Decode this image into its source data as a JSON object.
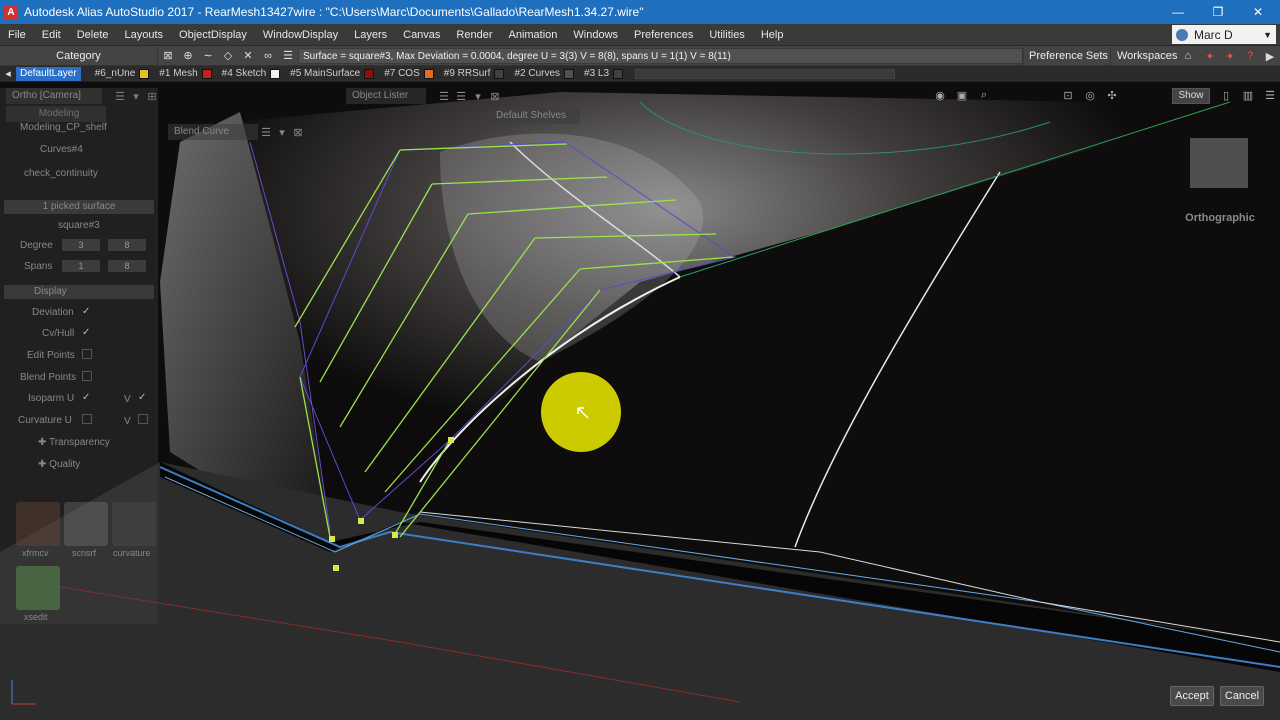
{
  "window": {
    "title": "Autodesk Alias AutoStudio 2017      - RearMesh13427wire : \"C:\\Users\\Marc\\Documents\\Gallado\\RearMesh1.34.27.wire\"",
    "controls": [
      "—",
      "❐",
      "✕"
    ]
  },
  "menu": {
    "items": [
      "File",
      "Edit",
      "Delete",
      "Layouts",
      "ObjectDisplay",
      "WindowDisplay",
      "Layers",
      "Canvas",
      "Render",
      "Animation",
      "Windows",
      "Preferences",
      "Utilities",
      "Help"
    ],
    "user": "Marc D"
  },
  "toolbar": {
    "category": "Category",
    "info": "Surface = square#3, Max Deviation = 0.0004, degree U = 3(3) V = 8(8), spans U = 1(1) V = 8(11)",
    "preference_sets": "Preference Sets",
    "workspaces": "Workspaces"
  },
  "layers": [
    {
      "label": "DefaultLayer",
      "color": "#2a6fc9",
      "active": true
    },
    {
      "label": "#6_nUne",
      "color": "#e8c020"
    },
    {
      "label": "#1 Mesh",
      "color": "#c02020"
    },
    {
      "label": "#4 Sketch",
      "color": "#f0f0f0"
    },
    {
      "label": "#5 MainSurface",
      "color": "#8a1010"
    },
    {
      "label": "#7 COS",
      "color": "#e07020"
    },
    {
      "label": "#9 RRSurf",
      "color": "#404040"
    },
    {
      "label": "#2 Curves",
      "color": "#505050"
    },
    {
      "label": "#3 L3",
      "color": "#404040"
    }
  ],
  "viewport": {
    "camera_label": "Ortho [Camera]",
    "modeling_label": "Modeling",
    "object_lister": "Object Lister",
    "default_shelves": "Default Shelves",
    "blend_curve": "Blend Curve",
    "view_label": "Orthographic",
    "show_button": "Show"
  },
  "leftpanel": {
    "shelf": "Modeling_CP_shelf",
    "curves": "Curves#4",
    "check": "check_continuity",
    "picked": "1 picked surface",
    "surface_name": "square#3",
    "degree_label": "Degree",
    "degree_u": "3",
    "degree_v": "8",
    "spans_label": "Spans",
    "spans_u": "1",
    "spans_v": "8",
    "display_label": "Display",
    "deviation": "Deviation",
    "cv_hull": "Cv/Hull",
    "edit_points": "Edit Points",
    "blend_points": "Blend Points",
    "isoparm_u": "Isoparm U",
    "curvature_u": "Curvature U",
    "v_label": "V",
    "transparency": "Transparency",
    "quality": "Quality",
    "tools": [
      "xfrmcv",
      "scnsrf",
      "curvature",
      "xsedit"
    ]
  },
  "actions": {
    "accept": "Accept",
    "cancel": "Cancel"
  },
  "colors": {
    "title_bar": "#1f6fbf",
    "curve_green": "#9be34a",
    "hull_blue": "#4a4ad0",
    "cursor_highlight": "#d6d600"
  }
}
